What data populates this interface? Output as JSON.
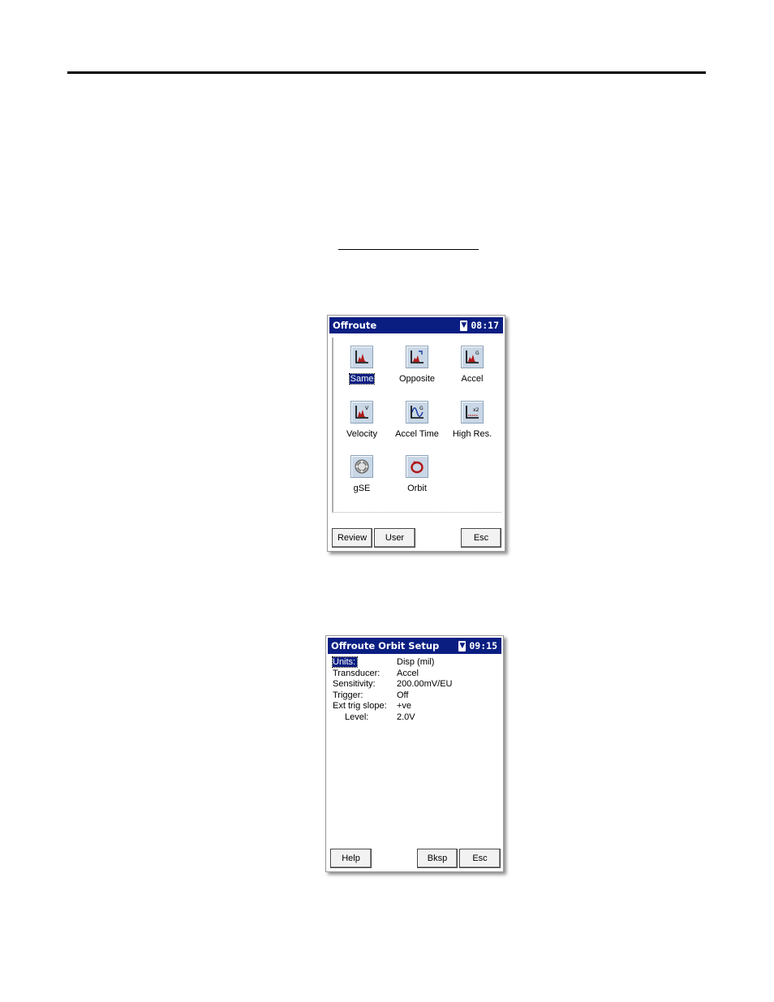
{
  "screen1": {
    "title": "Offroute",
    "battery_icon": "battery-icon",
    "time": "08:17",
    "icons": [
      {
        "label": "Same",
        "icon": "spectrum-icon",
        "selected": true
      },
      {
        "label": "Opposite",
        "icon": "spectrum-opposite-icon",
        "selected": false
      },
      {
        "label": "Accel",
        "icon": "spectrum-accel-icon",
        "selected": false
      },
      {
        "label": "Velocity",
        "icon": "spectrum-velocity-icon",
        "selected": false
      },
      {
        "label": "Accel Time",
        "icon": "waveform-icon",
        "selected": false
      },
      {
        "label": "High Res.",
        "icon": "high-res-icon",
        "selected": false
      },
      {
        "label": "gSE",
        "icon": "bearing-icon",
        "selected": false
      },
      {
        "label": "Orbit",
        "icon": "orbit-icon",
        "selected": false
      }
    ],
    "buttons": {
      "review": "Review",
      "user": "User",
      "esc": "Esc"
    }
  },
  "screen2": {
    "title": "Offroute Orbit Setup",
    "battery_icon": "battery-icon",
    "time": "09:15",
    "rows": [
      {
        "label": "Units:",
        "value": "Disp (mil)"
      },
      {
        "label": "Transducer:",
        "value": "Accel"
      },
      {
        "label": "Sensitivity:",
        "value": "200.00mV/EU"
      },
      {
        "label": "Trigger:",
        "value": "Off"
      },
      {
        "label": "Ext trig slope:",
        "value": "+ve"
      },
      {
        "label": "Level:",
        "value": "2.0V"
      }
    ],
    "buttons": {
      "help": "Help",
      "bksp": "Bksp",
      "esc": "Esc"
    }
  },
  "colors": {
    "titlebar": "#0a1e82",
    "selection": "#0a1e82",
    "icon_bg": "#c9d7e6",
    "icon_graph": "#b01818"
  }
}
